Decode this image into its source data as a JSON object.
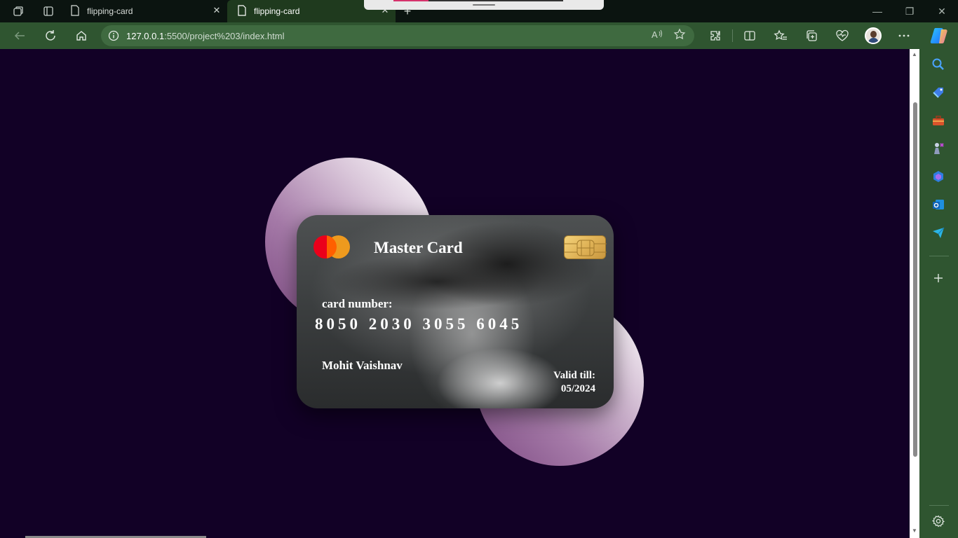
{
  "browser": {
    "tabs": [
      {
        "title": "flipping-card",
        "active": false
      },
      {
        "title": "flipping-card",
        "active": true
      }
    ],
    "address": {
      "host": "127.0.0.1",
      "path": ":5500/project%203/index.html"
    }
  },
  "colors": {
    "page_background": "#120126",
    "toolbar": "#2f5530",
    "tabstrip": "#0b1410",
    "mastercard_red": "#eb001b",
    "mastercard_orange": "#f79e1b",
    "chip_gold": "#e0b357"
  },
  "card": {
    "brand": "Master Card",
    "number_label": "card number:",
    "number": "8050 2030 3055 6045",
    "holder": "Mohit Vaishnav",
    "valid_label": "Valid till:",
    "valid_date": "05/2024"
  },
  "icons": {
    "sidebar": [
      "search-icon",
      "tag-icon",
      "toolbox-icon",
      "chess-icon",
      "m365-icon",
      "outlook-icon",
      "send-icon",
      "add-icon",
      "settings-icon"
    ]
  }
}
